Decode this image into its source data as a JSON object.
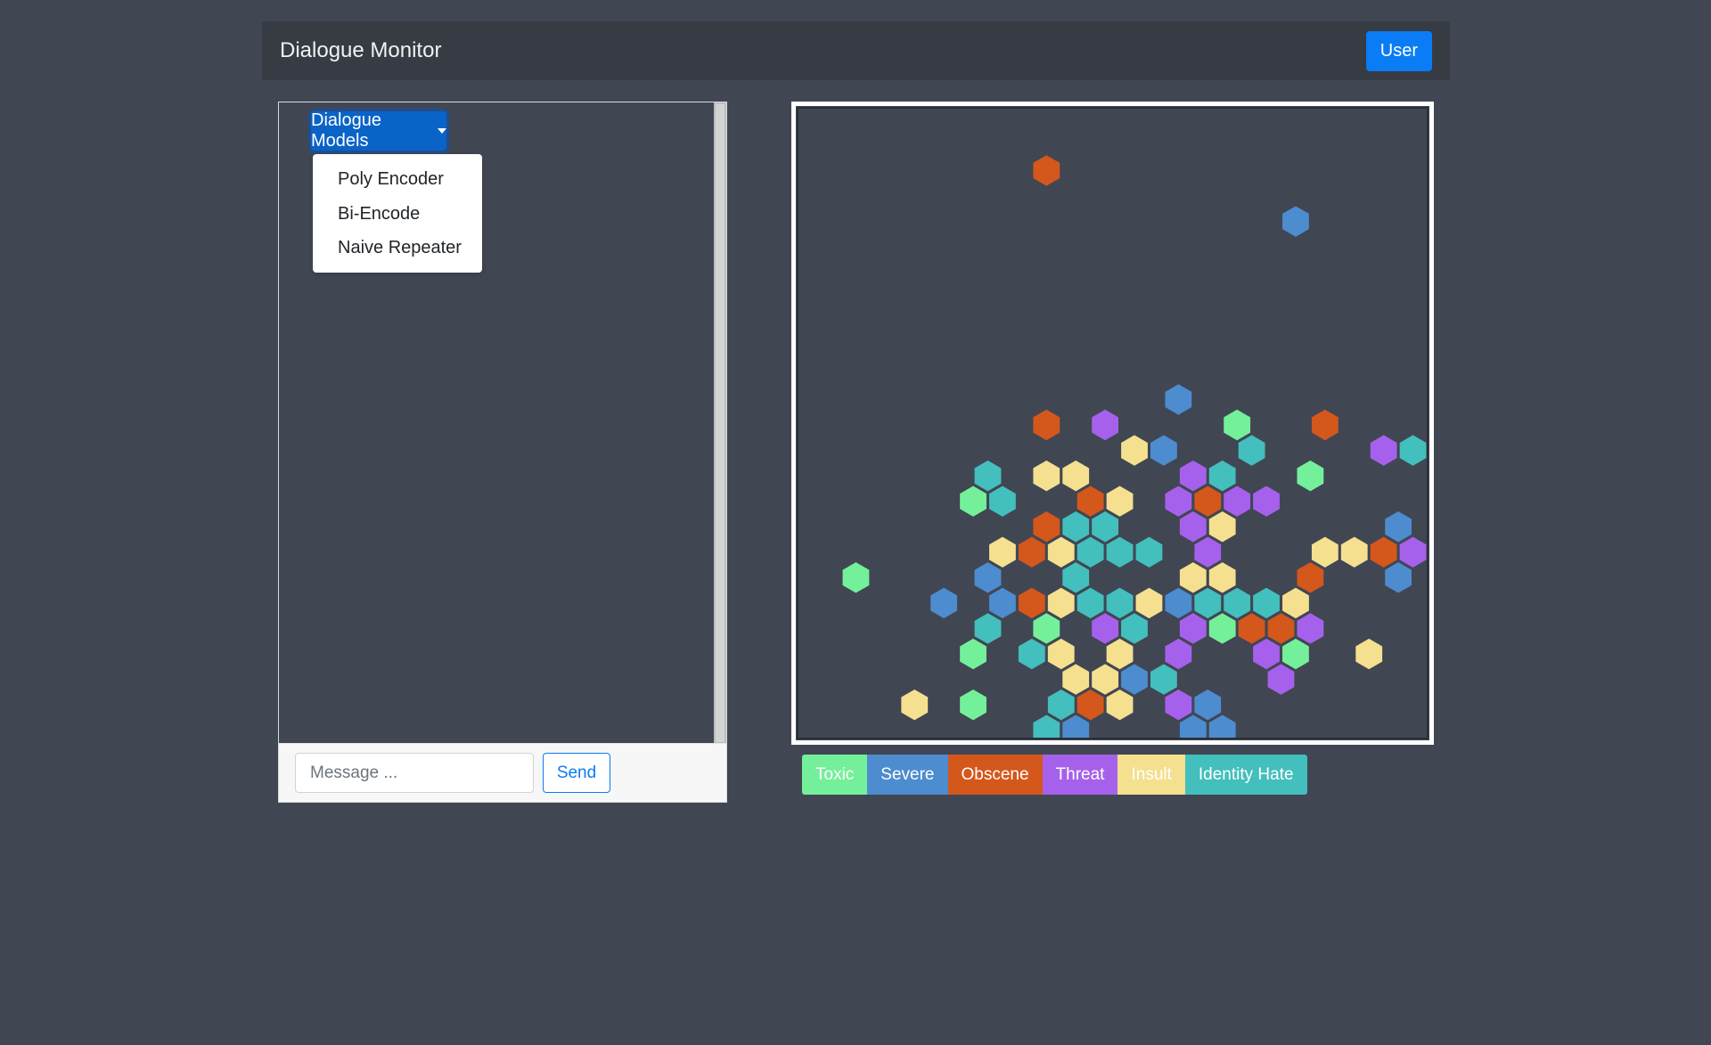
{
  "header": {
    "title": "Dialogue Monitor",
    "user_label": "User"
  },
  "chat": {
    "dropdown": {
      "label": "Dialogue Models",
      "items": [
        "Poly Encoder",
        "Bi-Encode",
        "Naive Repeater"
      ]
    },
    "input_placeholder": "Message ...",
    "send_label": "Send"
  },
  "legend": [
    {
      "label": "Toxic",
      "color": "#74f09a",
      "text_color": "#ffffff"
    },
    {
      "label": "Severe",
      "color": "#4d8ccf",
      "text_color": "#ffffff"
    },
    {
      "label": "Obscene",
      "color": "#d4571c",
      "text_color": "#ffffff"
    },
    {
      "label": "Threat",
      "color": "#a661ec",
      "text_color": "#ffffff"
    },
    {
      "label": "Insult",
      "color": "#f4e08f",
      "text_color": "#ffffff"
    },
    {
      "label": "Identity Hate",
      "color": "#43bfbd",
      "text_color": "#ffffff"
    }
  ],
  "hexbin": {
    "colors": {
      "toxic": "#74f09a",
      "severe": "#4d8ccf",
      "obscene": "#d4571c",
      "threat": "#a661ec",
      "insult": "#f4e08f",
      "identity_hate": "#43bfbd"
    }
  }
}
